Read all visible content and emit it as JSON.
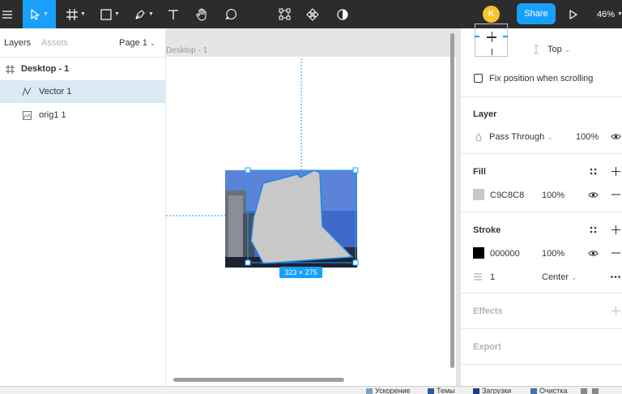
{
  "toolbar": {
    "menu_icon": "hamburger-menu-icon",
    "tools": [
      "move-tool",
      "frame-tool",
      "shape-tool",
      "pen-tool",
      "text-tool",
      "hand-tool",
      "comment-tool"
    ],
    "center_tools": [
      "edit-object-tool",
      "component-tool",
      "mask-tool"
    ],
    "avatar_initial": "K",
    "share_label": "Share",
    "zoom": "46%",
    "accent_color": "#18a0fb"
  },
  "left_panel": {
    "tabs": {
      "layers": "Layers",
      "assets": "Assets"
    },
    "page_selector": "Page 1",
    "layers": [
      {
        "label": "Desktop - 1",
        "icon": "frame-icon",
        "bold": true
      },
      {
        "label": "Vector 1",
        "icon": "vector-icon",
        "selected": true
      },
      {
        "label": "orig1 1",
        "icon": "image-icon"
      }
    ]
  },
  "canvas": {
    "frame_label": "Desktop - 1",
    "selection_size": "323 × 275"
  },
  "right_panel": {
    "constraint_top": "Top",
    "fix_position_label": "Fix position when scrolling",
    "layer": {
      "title": "Layer",
      "blend": "Pass Through",
      "opacity": "100%"
    },
    "fill": {
      "title": "Fill",
      "hex": "C9C8C8",
      "opacity": "100%",
      "color": "#c9c8c8"
    },
    "stroke": {
      "title": "Stroke",
      "hex": "000000",
      "opacity": "100%",
      "color": "#000000",
      "weight": "1",
      "position": "Center"
    },
    "effects": {
      "title": "Effects"
    },
    "export": {
      "title": "Export"
    }
  },
  "statusbar": {
    "items": [
      "Ускорение",
      "Темы",
      "Загрузки",
      "Очистка"
    ]
  }
}
